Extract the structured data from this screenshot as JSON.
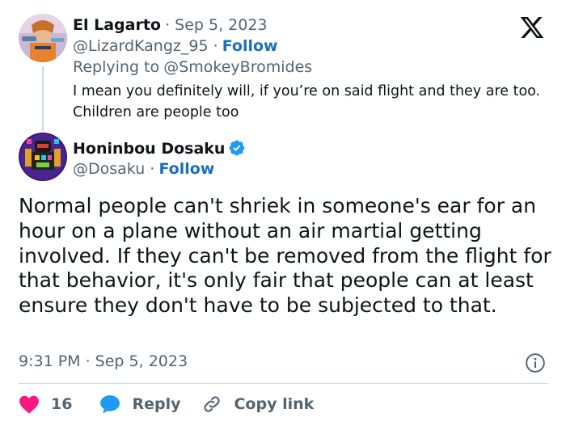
{
  "parent_tweet": {
    "display_name": "El Lagarto",
    "date": "· Sep 5, 2023",
    "handle": "@LizardKangz_95 ·",
    "follow_label": "Follow",
    "replying_to_prefix": "Replying to",
    "replying_to_handle": "@SmokeyBromides",
    "text": "I mean you definitely will, if you’re on said flight and they are too. Children are people too"
  },
  "main_tweet": {
    "display_name": "Honinbou Dosaku",
    "handle": "@Dosaku ·",
    "follow_label": "Follow",
    "text": "Normal people can't shriek in someone's ear for an hour on a plane without an air martial getting involved. If they can't be removed from the flight for that behavior, it's only fair that people can at least ensure they don't have to be subjected to that.",
    "timestamp": "9:31 PM · Sep 5, 2023"
  },
  "actions": {
    "like_count": "16",
    "reply_label": "Reply",
    "copy_link_label": "Copy link"
  },
  "colors": {
    "accent": "#1d9bf0",
    "like": "#f91880",
    "muted": "#536471"
  },
  "icons": [
    "x-logo-icon",
    "verified-badge-icon",
    "info-icon",
    "heart-icon",
    "reply-bubble-icon",
    "link-icon"
  ]
}
